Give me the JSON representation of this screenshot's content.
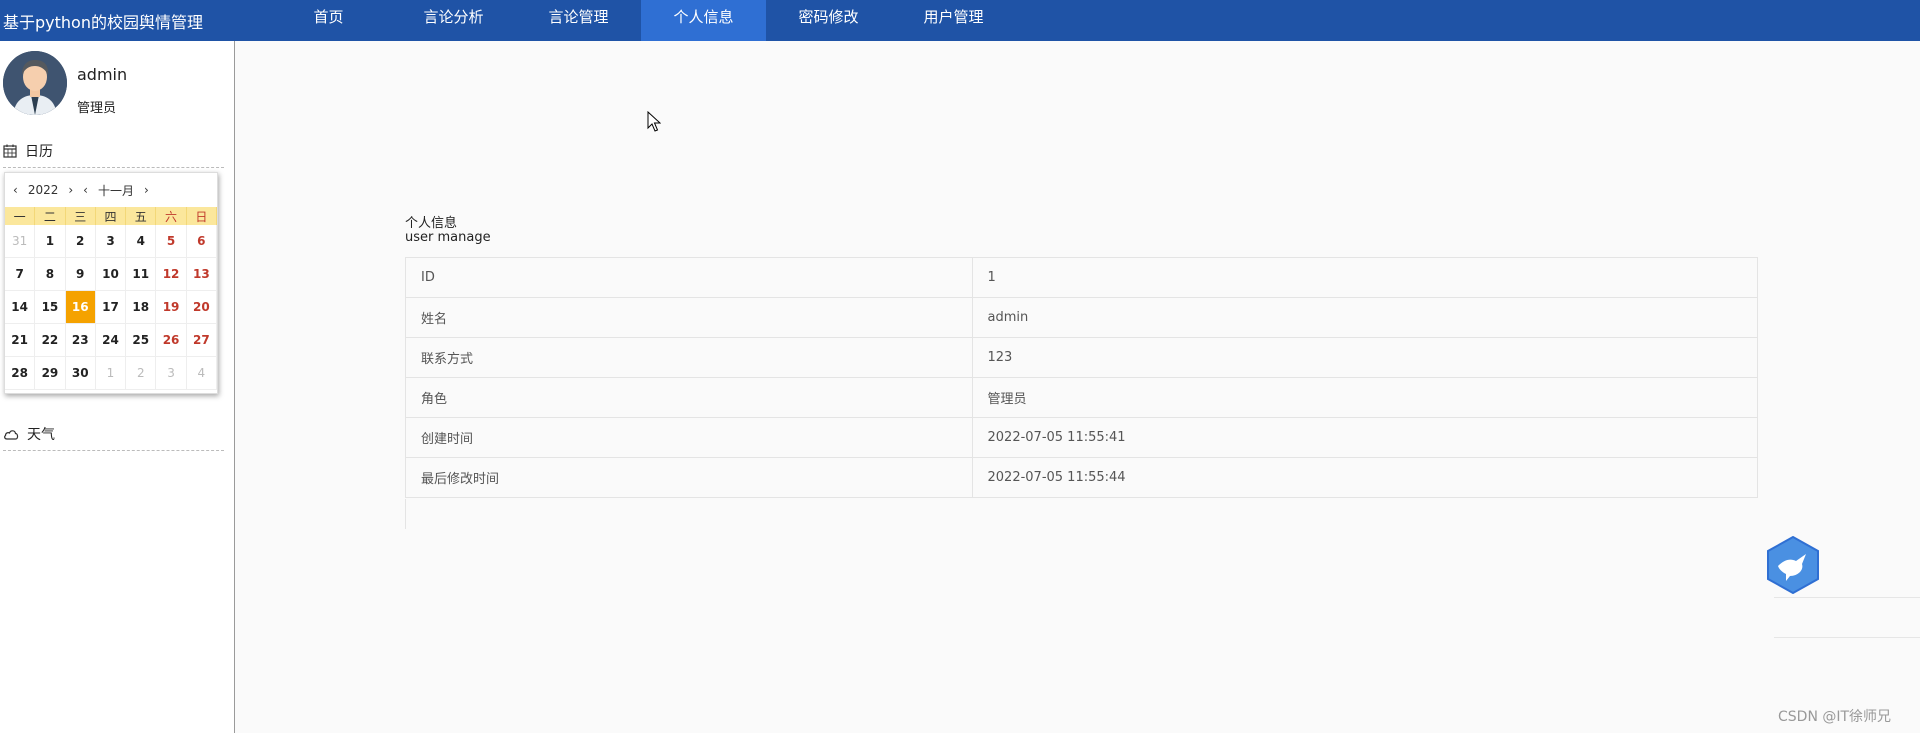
{
  "app": {
    "title": "基于python的校园舆情管理"
  },
  "nav": {
    "items": [
      {
        "label": "首页"
      },
      {
        "label": "言论分析"
      },
      {
        "label": "言论管理"
      },
      {
        "label": "个人信息"
      },
      {
        "label": "密码修改"
      },
      {
        "label": "用户管理"
      }
    ],
    "active": "个人信息"
  },
  "sidebar": {
    "user": {
      "name": "admin",
      "role": "管理员"
    },
    "calendar": {
      "title": "日历",
      "year": "2022",
      "month": "十一月",
      "prev_year": "‹",
      "next_year": "›",
      "prev_month": "‹",
      "next_month": "›",
      "weekdays": [
        "一",
        "二",
        "三",
        "四",
        "五",
        "六",
        "日"
      ],
      "days": [
        {
          "d": "31",
          "m": true
        },
        {
          "d": "1"
        },
        {
          "d": "2"
        },
        {
          "d": "3"
        },
        {
          "d": "4"
        },
        {
          "d": "5"
        },
        {
          "d": "6"
        },
        {
          "d": "7"
        },
        {
          "d": "8"
        },
        {
          "d": "9"
        },
        {
          "d": "10"
        },
        {
          "d": "11"
        },
        {
          "d": "12"
        },
        {
          "d": "13"
        },
        {
          "d": "14"
        },
        {
          "d": "15"
        },
        {
          "d": "16",
          "today": true
        },
        {
          "d": "17"
        },
        {
          "d": "18"
        },
        {
          "d": "19"
        },
        {
          "d": "20"
        },
        {
          "d": "21"
        },
        {
          "d": "22"
        },
        {
          "d": "23"
        },
        {
          "d": "24"
        },
        {
          "d": "25"
        },
        {
          "d": "26"
        },
        {
          "d": "27"
        },
        {
          "d": "28"
        },
        {
          "d": "29"
        },
        {
          "d": "30"
        },
        {
          "d": "1",
          "m": true
        },
        {
          "d": "2",
          "m": true
        },
        {
          "d": "3",
          "m": true
        },
        {
          "d": "4",
          "m": true
        }
      ]
    },
    "weather": {
      "title": "天气"
    }
  },
  "main": {
    "title": "个人信息",
    "subtitle": "user manage",
    "rows": [
      {
        "label": "ID",
        "value": "1"
      },
      {
        "label": "姓名",
        "value": "admin"
      },
      {
        "label": "联系方式",
        "value": "123"
      },
      {
        "label": "角色",
        "value": "管理员"
      },
      {
        "label": "创建时间",
        "value": "2022-07-05 11:55:41"
      },
      {
        "label": "最后修改时间",
        "value": "2022-07-05 11:55:44"
      }
    ]
  },
  "watermark": "CSDN @IT徐师兄",
  "colors": {
    "nav_bg": "#1f53a6",
    "nav_active": "#2f6fd3",
    "today": "#f5a200",
    "weekday_bar": "#fbe79c",
    "weekend": "#c0392b"
  }
}
